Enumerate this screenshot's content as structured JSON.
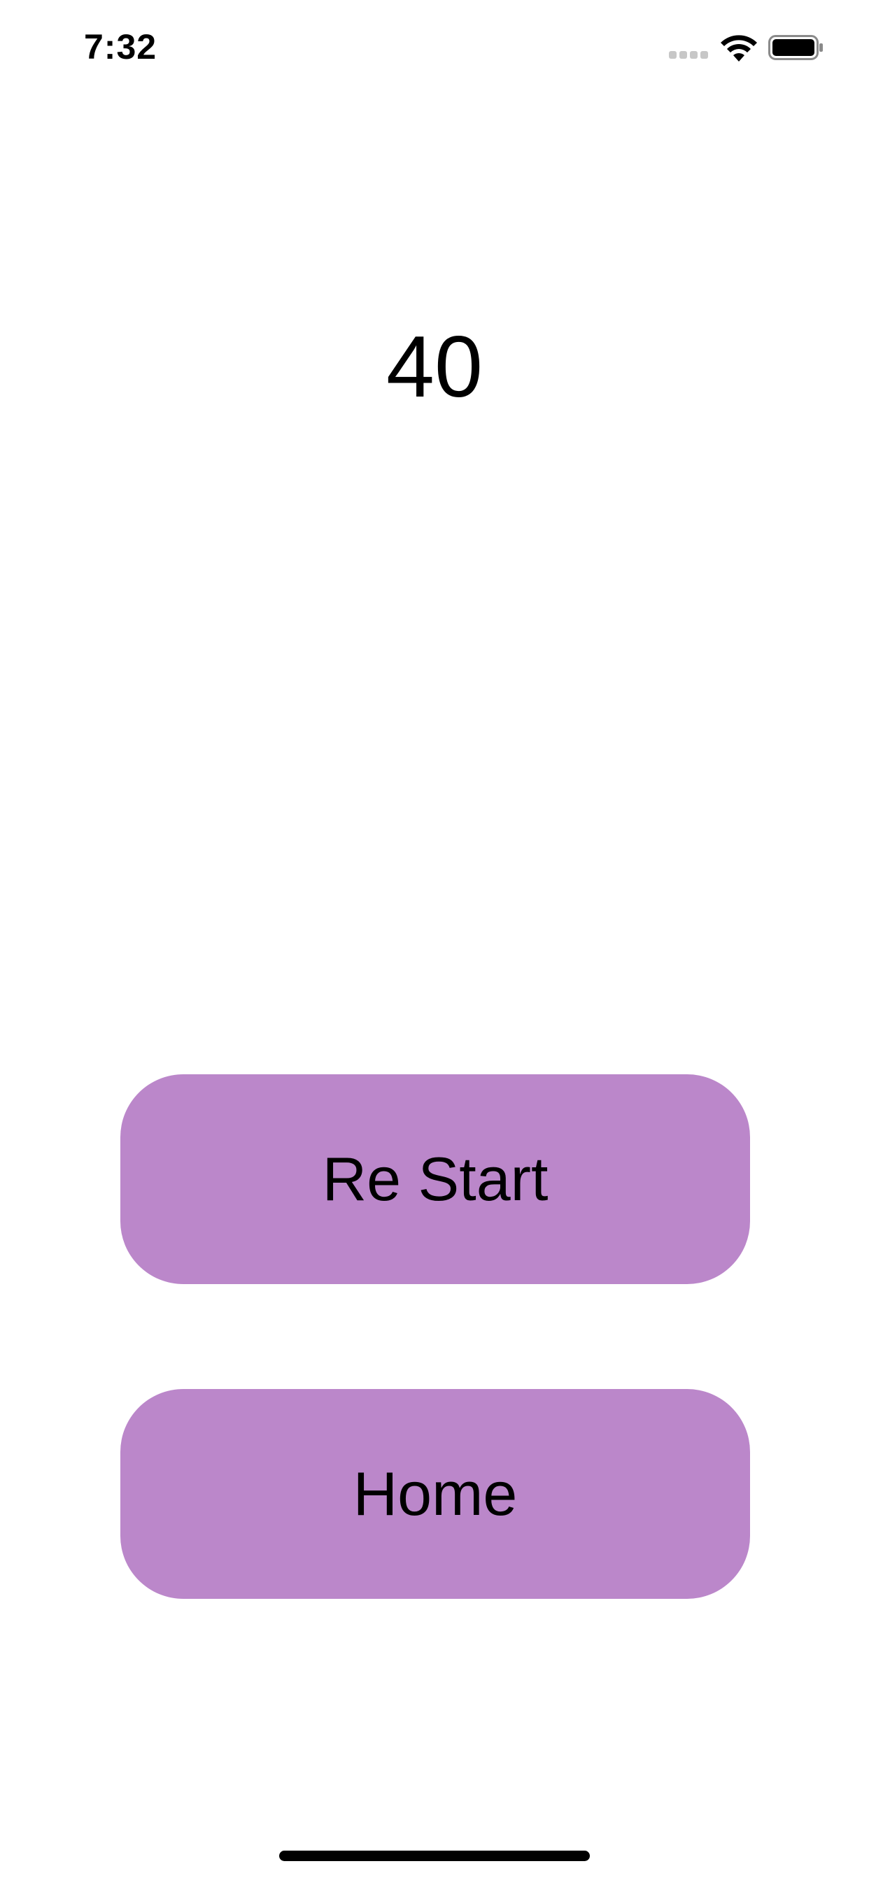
{
  "status_bar": {
    "time": "7:32",
    "icons": [
      "cellular-signal-icon",
      "wifi-icon",
      "battery-icon"
    ]
  },
  "game": {
    "score": "40"
  },
  "buttons": {
    "restart_label": "Re Start",
    "home_label": "Home"
  },
  "colors": {
    "button_background": "#bb87ca",
    "page_background": "#ffffff",
    "text": "#000000"
  }
}
